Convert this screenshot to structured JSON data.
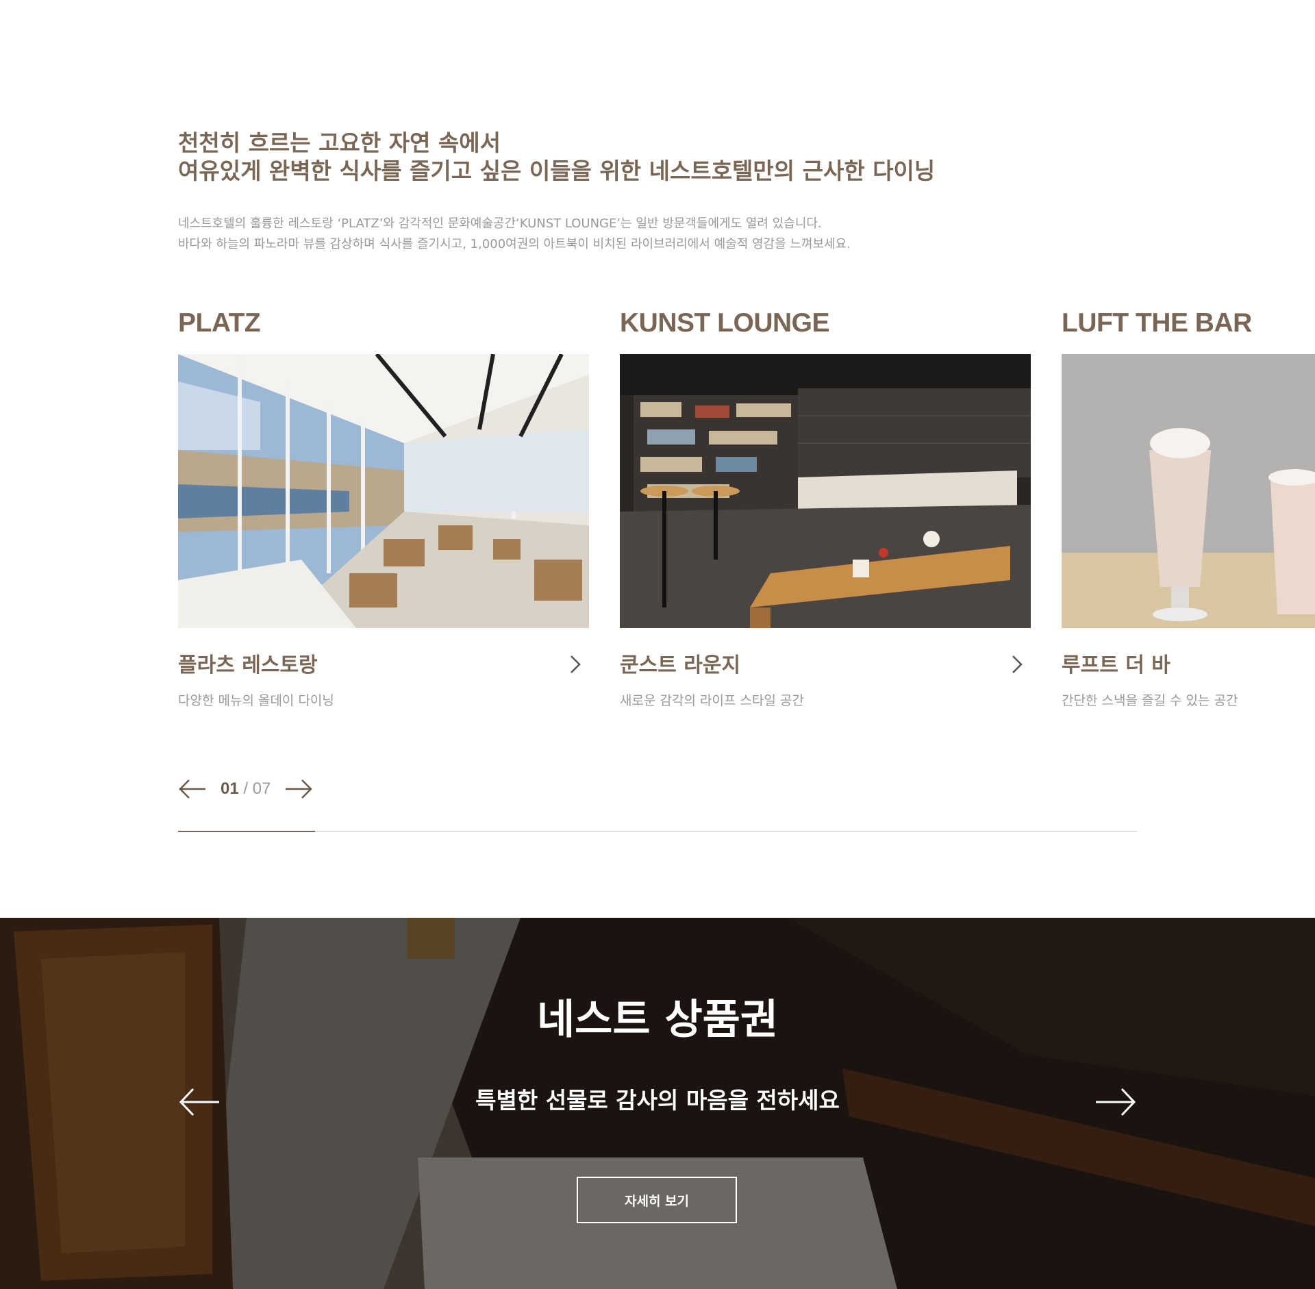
{
  "intro": {
    "headline_lines": [
      "천천히 흐르는 고요한 자연 속에서",
      "여유있게 완벽한 식사를 즐기고 싶은 이들을 위한 네스트호텔만의 근사한 다이닝"
    ],
    "description_lines": [
      "네스트호텔의 훌륭한 레스토랑 ‘PLATZ’와 감각적인 문화예술공간‘KUNST LOUNGE’는 일반 방문객들에게도 열려 있습니다.",
      "바다와 하늘의 파노라마 뷰를 감상하며 식사를 즐기시고, 1,000여권의 아트북이 비치된 라이브러리에서 예술적 영감을 느껴보세요."
    ]
  },
  "cards": [
    {
      "title": "PLATZ",
      "name": "플라츠 레스토랑",
      "desc": "다양한 메뉴의 올데이 다이닝",
      "photo": "restaurant-interior-photo"
    },
    {
      "title": "KUNST LOUNGE",
      "name": "쿤스트 라운지",
      "desc": "새로운 감각의 라이프 스타일 공간",
      "photo": "lounge-library-photo"
    },
    {
      "title": "LUFT THE BAR",
      "name": "루프트 더 바",
      "desc": "간단한 스낵을 즐길 수 있는 공간",
      "photo": "milkshake-drinks-photo"
    }
  ],
  "pager": {
    "current": "01",
    "separator": "/",
    "total": "07",
    "progress": 0.143
  },
  "voucher": {
    "title": "네스트 상품권",
    "subtitle": "특별한 선물로 감사의 마음을 전하세요",
    "button_label": "자세히 보기"
  },
  "colors": {
    "brand": "#7a6654",
    "muted": "#999999",
    "track": "#e0e0e0"
  }
}
